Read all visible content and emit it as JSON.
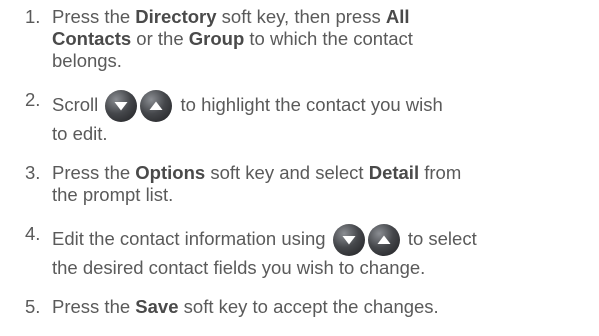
{
  "steps": [
    {
      "number": "1.",
      "t1": "Press the ",
      "b1": "Directory",
      "t2": " soft key, then press ",
      "b2": "All",
      "b3": "Contacts",
      "t3": " or the ",
      "b4": "Group",
      "t4": " to which the contact",
      "t5": "belongs."
    },
    {
      "number": "2.",
      "t1": "Scroll",
      "t2": " to highlight the contact you wish",
      "t3": "to edit.",
      "icons": [
        "down-arrow-button-icon",
        "up-arrow-button-icon"
      ]
    },
    {
      "number": "3.",
      "t1": "Press the ",
      "b1": "Options",
      "t2": " soft key and select ",
      "b2": "Detail",
      "t3": " from",
      "t4": "the prompt list."
    },
    {
      "number": "4.",
      "t1": "Edit the contact information using",
      "t2": " to select",
      "t3": "the desired contact fields you wish to change.",
      "icons": [
        "down-arrow-button-icon",
        "up-arrow-button-icon"
      ]
    },
    {
      "number": "5.",
      "t1": "Press the ",
      "b1": "Save",
      "t2": " soft key to accept the changes."
    }
  ],
  "colors": {
    "text": "#5a5a5a",
    "button_dark": "#2f3033",
    "button_light": "#8a8d92",
    "arrow": "#ffffff"
  }
}
